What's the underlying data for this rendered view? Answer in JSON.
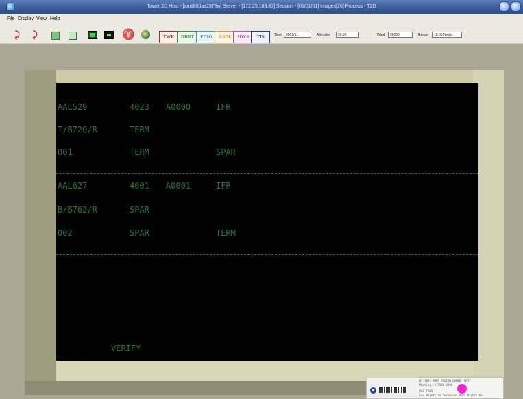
{
  "window": {
    "title": "Tower 2D  Host - [amii800aa2579w]  Server - [172.25.163.45]  Session - [01/01/01] Images[26] Process - T2D"
  },
  "menu": {
    "items": [
      "File",
      "Display",
      "View",
      "Help"
    ]
  },
  "toolbar": {
    "modes": [
      {
        "label": "TWR",
        "color": "#d01818"
      },
      {
        "label": "DBRT",
        "color": "#2e9e3a"
      },
      {
        "label": "FDIO",
        "color": "#2aa0d0"
      },
      {
        "label": "ASDE",
        "color": "#d8a020"
      },
      {
        "label": "IDVS",
        "color": "#e040d0"
      },
      {
        "label": "TIS",
        "color": "#2038c0"
      }
    ],
    "time_label": "Time",
    "time_value": "0001/51",
    "altimeter_label": "Altimeter",
    "altimeter_value": "29.93",
    "wind_label": "Wind",
    "wind_value": "36000",
    "range_label": "Range",
    "range_value": "10.00 Nm(s)"
  },
  "display": {
    "flights": [
      {
        "row1": [
          "AAL529",
          "4023",
          "A0000",
          "IFR"
        ],
        "row2": [
          "T/B72Q/R",
          "TERM"
        ],
        "row3": [
          "001",
          "TERM",
          "SPAR"
        ]
      },
      {
        "row1": [
          "AAL627",
          "4001",
          "A0001",
          "IFR"
        ],
        "row2": [
          "B/B762/R",
          "SPAR"
        ],
        "row3": [
          "002",
          "SPAR",
          "TERM"
        ]
      }
    ],
    "status": "VERIFY"
  },
  "sticker": {
    "line1": "B-17881 AMER REGION COMBO 'MATT",
    "line2": "Marking: 0-5548-4490",
    "line3": "NSC FAUS",
    "line4": "For Rights in Technical Data Rights Re"
  }
}
